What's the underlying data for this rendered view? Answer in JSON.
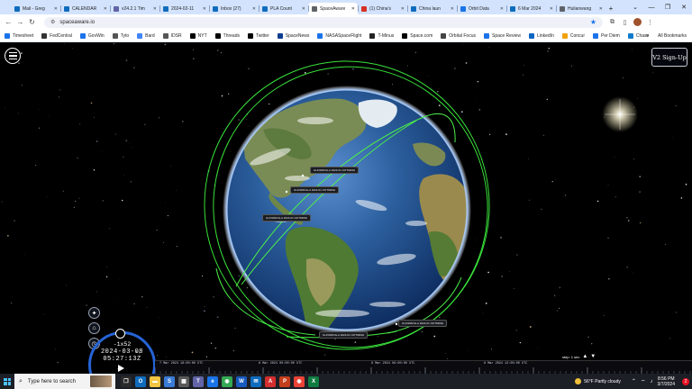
{
  "browser": {
    "tabs": [
      {
        "label": "Mail - Greg",
        "color": "#0f6cbd"
      },
      {
        "label": "CALENDAR",
        "color": "#0f6cbd"
      },
      {
        "label": "v24.2.1 Tim",
        "color": "#6264a7"
      },
      {
        "label": "2024-02-11",
        "color": "#0f6cbd"
      },
      {
        "label": "Inbox (27)",
        "color": "#0f6cbd"
      },
      {
        "label": "PLA Count",
        "color": "#0f6cbd"
      },
      {
        "label": "SpaceAware",
        "color": "#5f6368"
      },
      {
        "label": "(1) China's",
        "color": "#d93025"
      },
      {
        "label": "China laun",
        "color": "#0f6cbd"
      },
      {
        "label": "Orbit Data",
        "color": "#1a73e8"
      },
      {
        "label": "6 Mar 2024",
        "color": "#0f6cbd"
      },
      {
        "label": "Hulianwang",
        "color": "#5f6368"
      }
    ],
    "active_tab_index": 6,
    "url": "spaceaware.io",
    "bookmarks": [
      {
        "label": "Timesheet",
        "color": "#1a73e8"
      },
      {
        "label": "FedCentral",
        "color": "#333"
      },
      {
        "label": "GovWin",
        "color": "#1a73e8"
      },
      {
        "label": "Tyto",
        "color": "#555"
      },
      {
        "label": "Bard",
        "color": "#4285f4"
      },
      {
        "label": "IDSR",
        "color": "#555"
      },
      {
        "label": "NYT",
        "color": "#000"
      },
      {
        "label": "Threads",
        "color": "#000"
      },
      {
        "label": "Twitter",
        "color": "#000"
      },
      {
        "label": "SpaceNews",
        "color": "#0b3d91"
      },
      {
        "label": "NASASpaceFlight",
        "color": "#1a73e8"
      },
      {
        "label": "T-Minus",
        "color": "#222"
      },
      {
        "label": "Space.com",
        "color": "#000"
      },
      {
        "label": "Orbital Focus",
        "color": "#444"
      },
      {
        "label": "Space Review",
        "color": "#1a73e8"
      },
      {
        "label": "LinkedIn",
        "color": "#0a66c2"
      },
      {
        "label": "Concur",
        "color": "#f0a30a"
      },
      {
        "label": "Per Diem",
        "color": "#1a73e8"
      },
      {
        "label": "Chase",
        "color": "#117aca"
      }
    ],
    "all_bookmarks_label": "All Bookmarks"
  },
  "app": {
    "signup_label": "V2 Sign-Up",
    "satellite_labels": [
      "GUOWANG-A 2024-01 OOTM03H",
      "GUOWANG-A 2024-01 OOTM03H",
      "GUOWANG-A 2024-01 OOTM03H",
      "GUOWANG-A 2024-01 OOTM03H",
      "GUOWANG-A 2024-01 OOTM03H"
    ],
    "time": {
      "multiplier": "-1x52",
      "date": "2024-03-08",
      "clock": "05:27:13Z"
    },
    "timeline": {
      "labels": [
        "7 Mar 2024 18:00:00 UTC",
        "8 Mar 2024 00:00:00 UTC",
        "8 Mar 2024 06:00:00 UTC",
        "8 Mar 2024 12:00:00 UTC"
      ],
      "step_label": "step: 1 sec"
    }
  },
  "taskbar": {
    "search_placeholder": "Type here to search",
    "apps": [
      {
        "name": "task-view",
        "color": "#2b2b2b",
        "glyph": "❐"
      },
      {
        "name": "outlook",
        "color": "#0f6cbd",
        "glyph": "O"
      },
      {
        "name": "explorer",
        "color": "#f4c542",
        "glyph": "▬"
      },
      {
        "name": "store",
        "color": "#3a7bd5",
        "glyph": "S"
      },
      {
        "name": "calculator",
        "color": "#5a5a5a",
        "glyph": "▦"
      },
      {
        "name": "teams",
        "color": "#6264a7",
        "glyph": "T"
      },
      {
        "name": "edge",
        "color": "#1a73e8",
        "glyph": "e"
      },
      {
        "name": "chrome",
        "color": "#34a853",
        "glyph": "◉"
      },
      {
        "name": "word",
        "color": "#185abd",
        "glyph": "W"
      },
      {
        "name": "mail",
        "color": "#0f6cbd",
        "glyph": "✉"
      },
      {
        "name": "acrobat",
        "color": "#d32f2f",
        "glyph": "A"
      },
      {
        "name": "powerpoint",
        "color": "#c43e1c",
        "glyph": "P"
      },
      {
        "name": "chrome-2",
        "color": "#ea4335",
        "glyph": "◉"
      },
      {
        "name": "excel",
        "color": "#107c41",
        "glyph": "X"
      }
    ],
    "weather": "56°F  Partly cloudy",
    "time": "8:56 PM",
    "date": "3/7/2024",
    "notification_count": "2"
  }
}
